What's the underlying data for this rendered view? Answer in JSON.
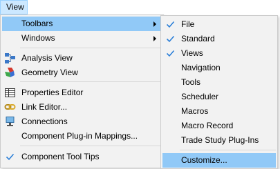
{
  "menubar": {
    "view_label": "View"
  },
  "main_menu": {
    "items": [
      {
        "label": "Toolbars"
      },
      {
        "label": "Windows"
      },
      {
        "label": "Analysis View"
      },
      {
        "label": "Geometry View"
      },
      {
        "label": "Properties Editor"
      },
      {
        "label": "Link Editor..."
      },
      {
        "label": "Connections"
      },
      {
        "label": "Component Plug-in Mappings..."
      },
      {
        "label": "Component Tool Tips"
      }
    ]
  },
  "sub_menu": {
    "items": [
      {
        "label": "File",
        "checked": true
      },
      {
        "label": "Standard",
        "checked": true
      },
      {
        "label": "Views",
        "checked": true
      },
      {
        "label": "Navigation",
        "checked": false
      },
      {
        "label": "Tools",
        "checked": false
      },
      {
        "label": "Scheduler",
        "checked": false
      },
      {
        "label": "Macros",
        "checked": false
      },
      {
        "label": "Macro Record",
        "checked": false
      },
      {
        "label": "Trade Study Plug-Ins",
        "checked": false
      },
      {
        "label": "Customize...",
        "checked": false
      }
    ]
  },
  "colors": {
    "highlight": "#91c9f7",
    "menubar_active": "#cce8ff",
    "check": "#2b7fd8"
  }
}
